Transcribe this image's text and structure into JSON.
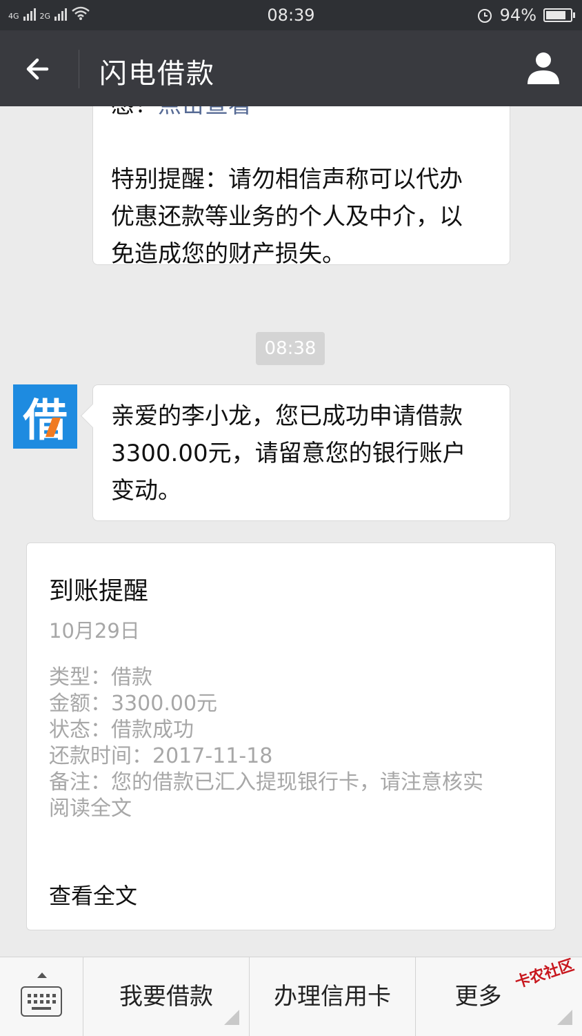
{
  "status_bar": {
    "network1": "4G",
    "network2": "2G",
    "time": "08:39",
    "battery": "94%",
    "battery_level": 0.94
  },
  "nav": {
    "title": "闪电借款"
  },
  "messages": {
    "first": {
      "top_text": "感！",
      "link": "点击查看",
      "lines": [
        "特别提醒：请勿相信声称可以代办",
        "优惠还款等业务的个人及中介，以",
        "免造成您的财产损失。"
      ]
    },
    "timestamp": "08:38",
    "avatar_char": "借",
    "second": {
      "lines": [
        "亲爱的李小龙，您已成功申请借款",
        "3300.00元，请留意您的银行账户",
        "变动。"
      ]
    }
  },
  "card": {
    "title": "到账提醒",
    "date": "10月29日",
    "rows": [
      "类型：借款",
      "金额：3300.00元",
      "状态：借款成功",
      "还款时间：2017-11-18",
      "备注：您的借款已汇入提现银行卡，请注意核实",
      "阅读全文"
    ],
    "view_full": "查看全文"
  },
  "bottom_menu": {
    "item1": "我要借款",
    "item2": "办理信用卡",
    "item3": "更多"
  },
  "watermark": "卡农社区"
}
